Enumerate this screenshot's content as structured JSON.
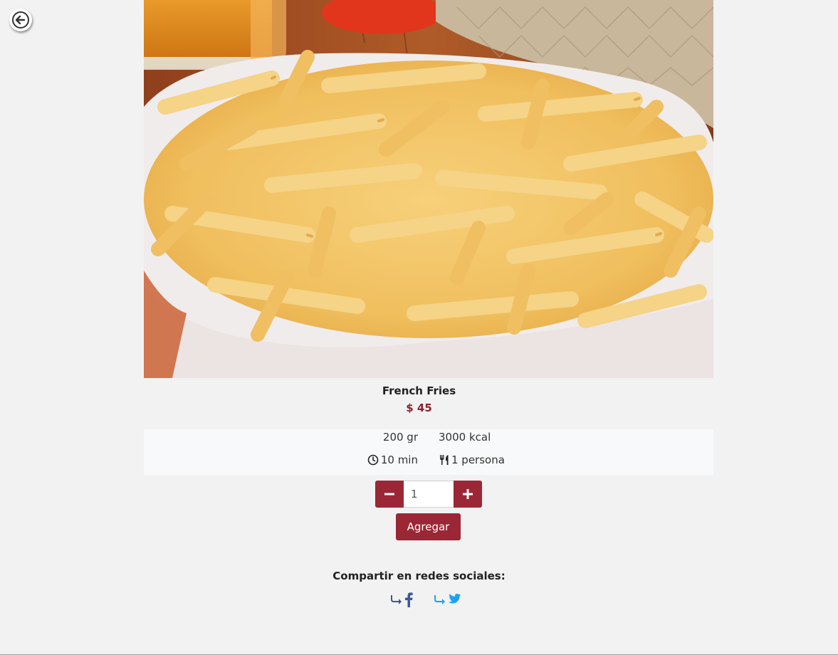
{
  "product": {
    "image_alt": "French fries",
    "name": "French Fries",
    "price": "$ 45"
  },
  "info": {
    "weight": "200 gr",
    "calories": "3000 kcal",
    "time": "10 min",
    "servings": "1 persona"
  },
  "quantity": {
    "value": "1"
  },
  "add_label": "Agregar",
  "share": {
    "title": "Compartir en redes sociales:"
  },
  "colors": {
    "accent": "#9b2635",
    "price": "#8c2231",
    "facebook": "#3b5998",
    "twitter": "#1da1f2"
  },
  "icons": [
    "back-arrow-icon",
    "clock-icon",
    "utensils-icon",
    "minus-icon",
    "plus-icon",
    "share-arrow-icon",
    "facebook-icon",
    "twitter-icon"
  ]
}
